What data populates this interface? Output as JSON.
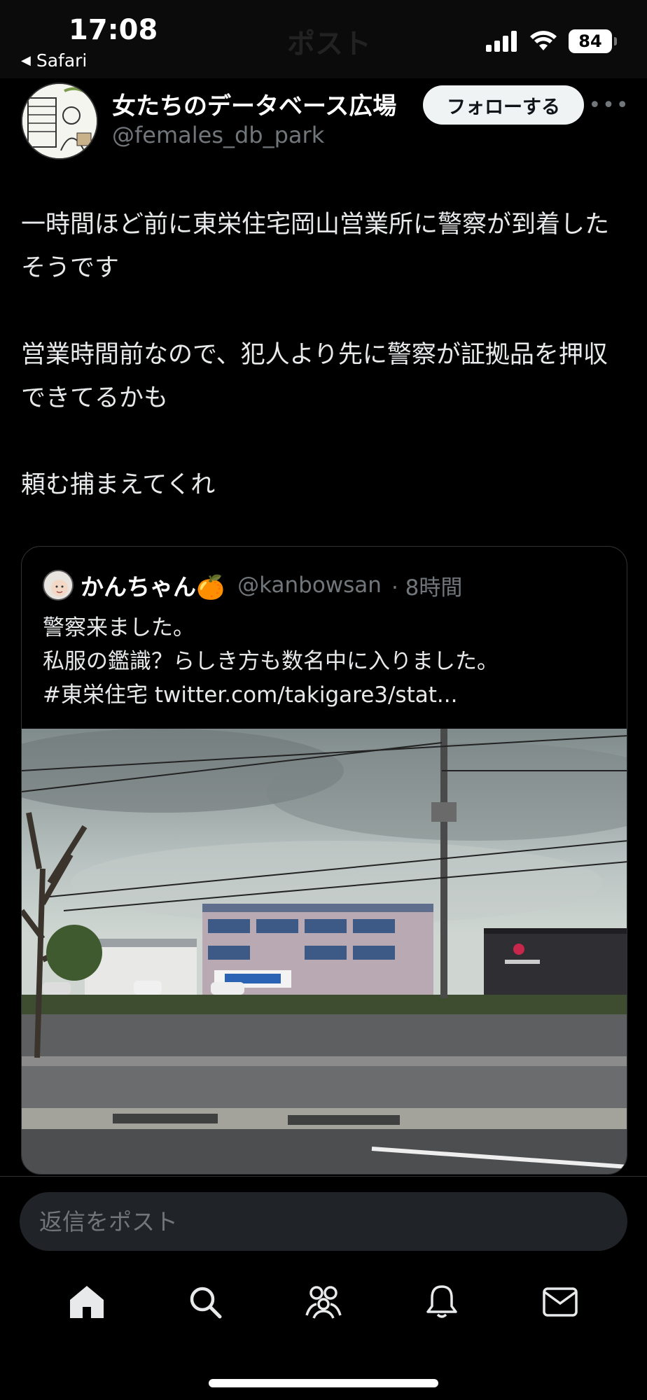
{
  "status_bar": {
    "time": "17:08",
    "back_app": "Safari",
    "battery": "84",
    "ghost_title": "ポスト"
  },
  "tweet": {
    "display_name": "女たちのデータベース広場",
    "handle": "@females_db_park",
    "follow_label": "フォローする",
    "paragraphs": [
      "一時間ほど前に東栄住宅岡山営業所に警察が到着したそうです",
      "営業時間前なので、犯人より先に警察が証拠品を押収できてるかも",
      "頼む捕まえてくれ"
    ]
  },
  "quote": {
    "display_name": "かんちゃん🍊",
    "handle": "@kanbowsan",
    "time": "· 8時間",
    "lines": [
      "警察来ました。",
      "私服の鑑識？らしき方も数名中に入りました。",
      "#東栄住宅 twitter.com/takigare3/stat..."
    ]
  },
  "reply": {
    "placeholder": "返信をポスト"
  },
  "nav": {
    "items": [
      "home",
      "search",
      "communities",
      "notifications",
      "messages"
    ]
  },
  "colors": {
    "background": "#000000",
    "text": "#e7e9ea",
    "muted": "#71767b",
    "border": "#2f3336",
    "input_bg": "#202327"
  }
}
